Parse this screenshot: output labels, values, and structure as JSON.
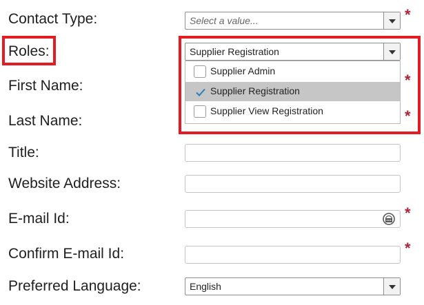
{
  "form": {
    "contact_type": {
      "label": "Contact Type:",
      "placeholder": "Select a value..."
    },
    "roles": {
      "label": "Roles:",
      "value": "Supplier Registration",
      "options": [
        {
          "label": "Supplier Admin",
          "checked": false
        },
        {
          "label": "Supplier Registration",
          "checked": true
        },
        {
          "label": "Supplier View Registration",
          "checked": false
        }
      ]
    },
    "first_name": {
      "label": "First Name:"
    },
    "last_name": {
      "label": "Last Name:"
    },
    "title": {
      "label": "Title:"
    },
    "website": {
      "label": "Website Address:"
    },
    "email": {
      "label": "E-mail Id:"
    },
    "confirm_email": {
      "label": "Confirm E-mail Id:"
    },
    "language": {
      "label": "Preferred Language:",
      "value": "English"
    },
    "required_mark": "*"
  },
  "icons": {
    "dropdown_arrow": "chevron-down-icon",
    "checkbox_check": "checkmark-icon",
    "email_assist": "key-icon"
  },
  "colors": {
    "highlight": "#e31b23",
    "required": "#b22234",
    "selected_option_bg": "#c6c6c6",
    "check": "#2a7fb8"
  }
}
